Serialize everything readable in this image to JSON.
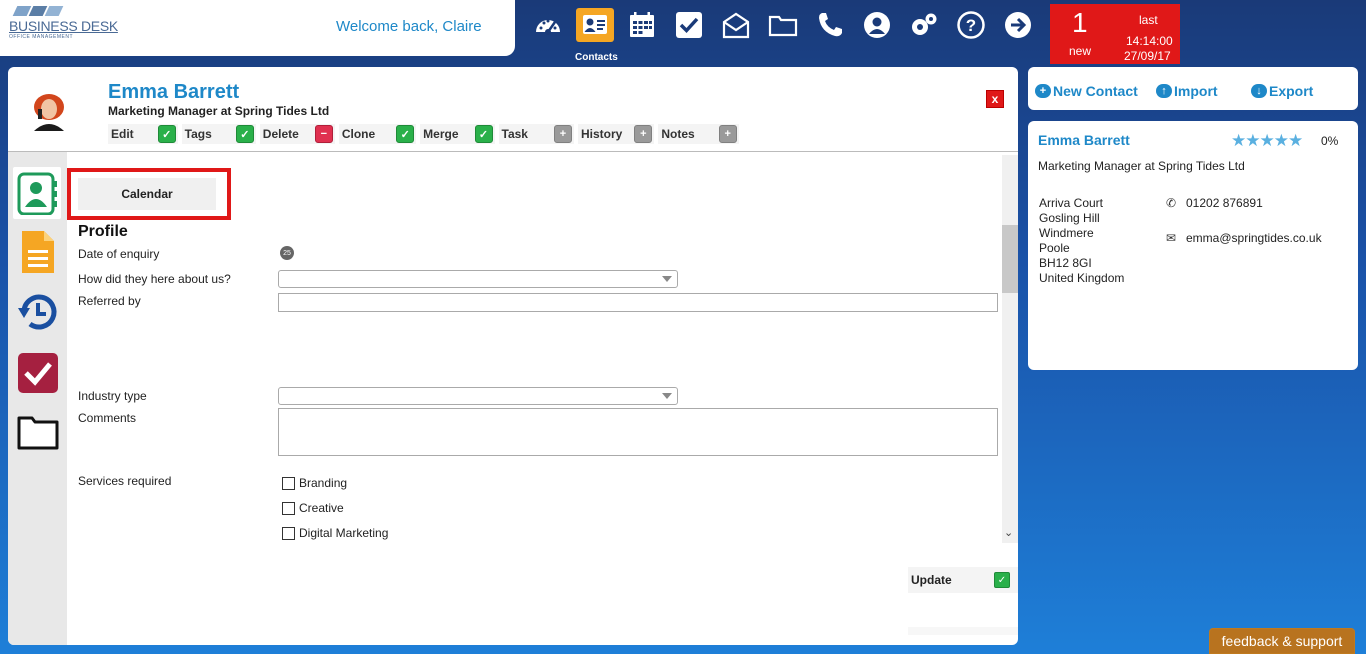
{
  "header": {
    "logo_name": "BUSINESS DESK",
    "logo_sub": "OFFICE MANAGEMENT",
    "welcome": "Welcome back, Claire",
    "active_nav_label": "Contacts",
    "nav_icons": [
      "dashboard-icon",
      "contacts-icon",
      "calendar-icon",
      "tasks-icon",
      "mail-icon",
      "folder-icon",
      "phone-icon",
      "user-icon",
      "settings-icon",
      "help-icon",
      "logout-icon"
    ]
  },
  "notification": {
    "count": "1",
    "count_label": "new",
    "last_label": "last",
    "time": "14:14:00",
    "date": "27/09/17"
  },
  "contact": {
    "name": "Emma Barrett",
    "role": "Marketing Manager at Spring Tides Ltd",
    "close": "x",
    "actions": [
      {
        "label": "Edit",
        "icon": "check"
      },
      {
        "label": "Tags",
        "icon": "check"
      },
      {
        "label": "Delete",
        "icon": "minus"
      },
      {
        "label": "Clone",
        "icon": "check"
      },
      {
        "label": "Merge",
        "icon": "check"
      },
      {
        "label": "Task",
        "icon": "plus"
      },
      {
        "label": "History",
        "icon": "plus"
      },
      {
        "label": "Notes",
        "icon": "plus"
      }
    ]
  },
  "sidebar": {
    "icons": [
      "contact-card-icon",
      "document-icon",
      "history-icon",
      "task-check-icon",
      "folder-icon"
    ]
  },
  "form": {
    "calendar_button": "Calendar",
    "section_title": "Profile",
    "date_of_enquiry": "Date of enquiry",
    "date_icon_text": "25",
    "how_heard": "How did they here about us?",
    "how_heard_value": "",
    "referred_by": "Referred by",
    "referred_by_value": "",
    "industry_type": "Industry type",
    "industry_type_value": "",
    "comments": "Comments",
    "comments_value": "",
    "services_required": "Services required",
    "services": [
      {
        "label": "Branding",
        "checked": false
      },
      {
        "label": "Creative",
        "checked": false
      },
      {
        "label": "Digital Marketing",
        "checked": false
      }
    ],
    "update": "Update"
  },
  "right_panel": {
    "new_contact": "New Contact",
    "import": "Import",
    "export": "Export",
    "card": {
      "name": "Emma Barrett",
      "stars": "★★★★★",
      "rating": "0%",
      "role": "Marketing Manager at Spring Tides Ltd",
      "address": [
        "Arriva Court",
        "Gosling Hill",
        "Windmere",
        "Poole",
        "BH12 8GI",
        "United Kingdom"
      ],
      "phone": "01202 876891",
      "email": "emma@springtides.co.uk"
    }
  },
  "feedback": "feedback & support",
  "colors": {
    "accent_blue": "#1e88c8",
    "alert_red": "#e01818",
    "active_orange": "#f5a623",
    "green": "#2ab04a"
  }
}
